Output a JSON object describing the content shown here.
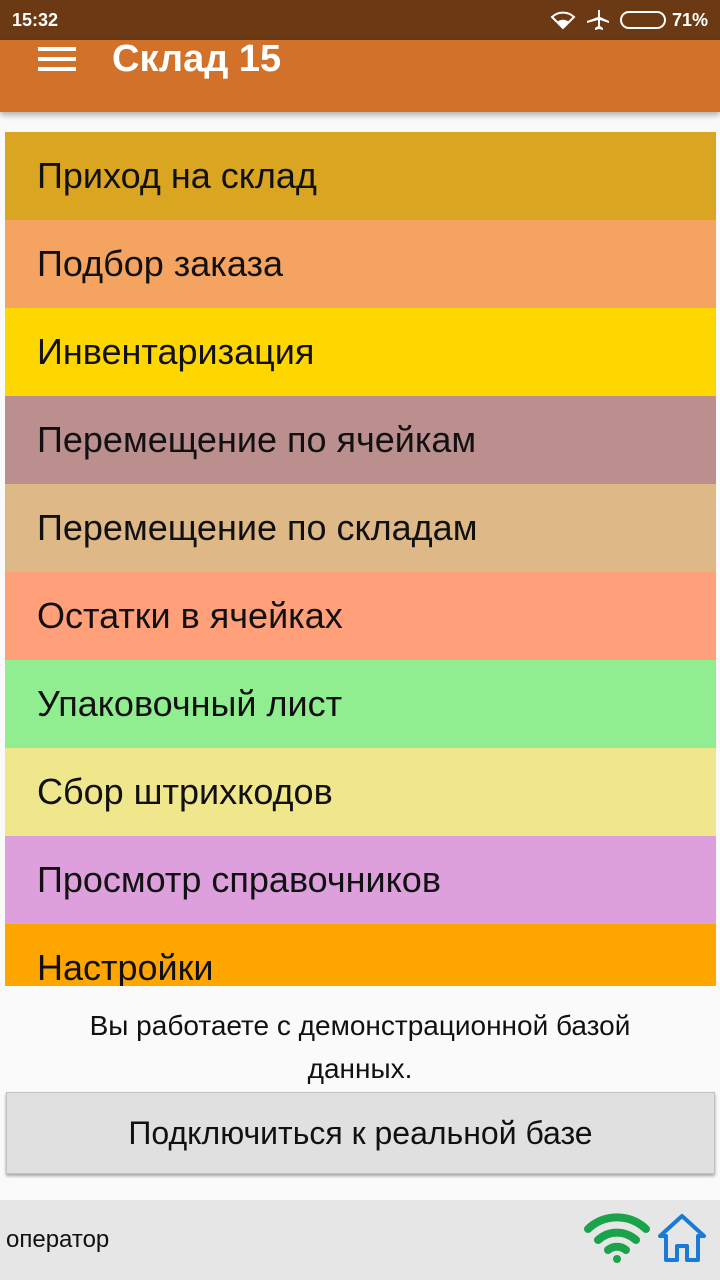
{
  "status_bar": {
    "time": "15:32",
    "battery": "71%",
    "battery_level": 0.71,
    "icons": [
      "wifi-icon",
      "airplane-icon",
      "battery-icon"
    ]
  },
  "app_bar": {
    "title": "Склад 15",
    "menu_icon": "hamburger-menu-icon"
  },
  "menu": {
    "items": [
      {
        "label": "Приход на склад",
        "color": "#daa520"
      },
      {
        "label": "Подбор заказа",
        "color": "#f4a460"
      },
      {
        "label": "Инвентаризация",
        "color": "#ffd700"
      },
      {
        "label": "Перемещение по ячейкам",
        "color": "#bc8f8f"
      },
      {
        "label": "Перемещение по складам",
        "color": "#deb887"
      },
      {
        "label": "Остатки в ячейках",
        "color": "#ffa07a"
      },
      {
        "label": "Упаковочный лист",
        "color": "#90ee90"
      },
      {
        "label": "Сбор штрихкодов",
        "color": "#f0e68c"
      },
      {
        "label": "Просмотр справочников",
        "color": "#dda0dd"
      },
      {
        "label": "Настройки",
        "color": "#ffa500"
      }
    ]
  },
  "notice": {
    "line1": "Вы работаете с демонстрационной базой",
    "line2": "данных."
  },
  "connect_button": {
    "label": "Подключиться к реальной базе"
  },
  "footer": {
    "user_label": "оператор",
    "icons": [
      "wifi-signal-icon",
      "home-icon"
    ],
    "wifi_color": "#1aa34a",
    "home_color": "#1a7bd6"
  }
}
